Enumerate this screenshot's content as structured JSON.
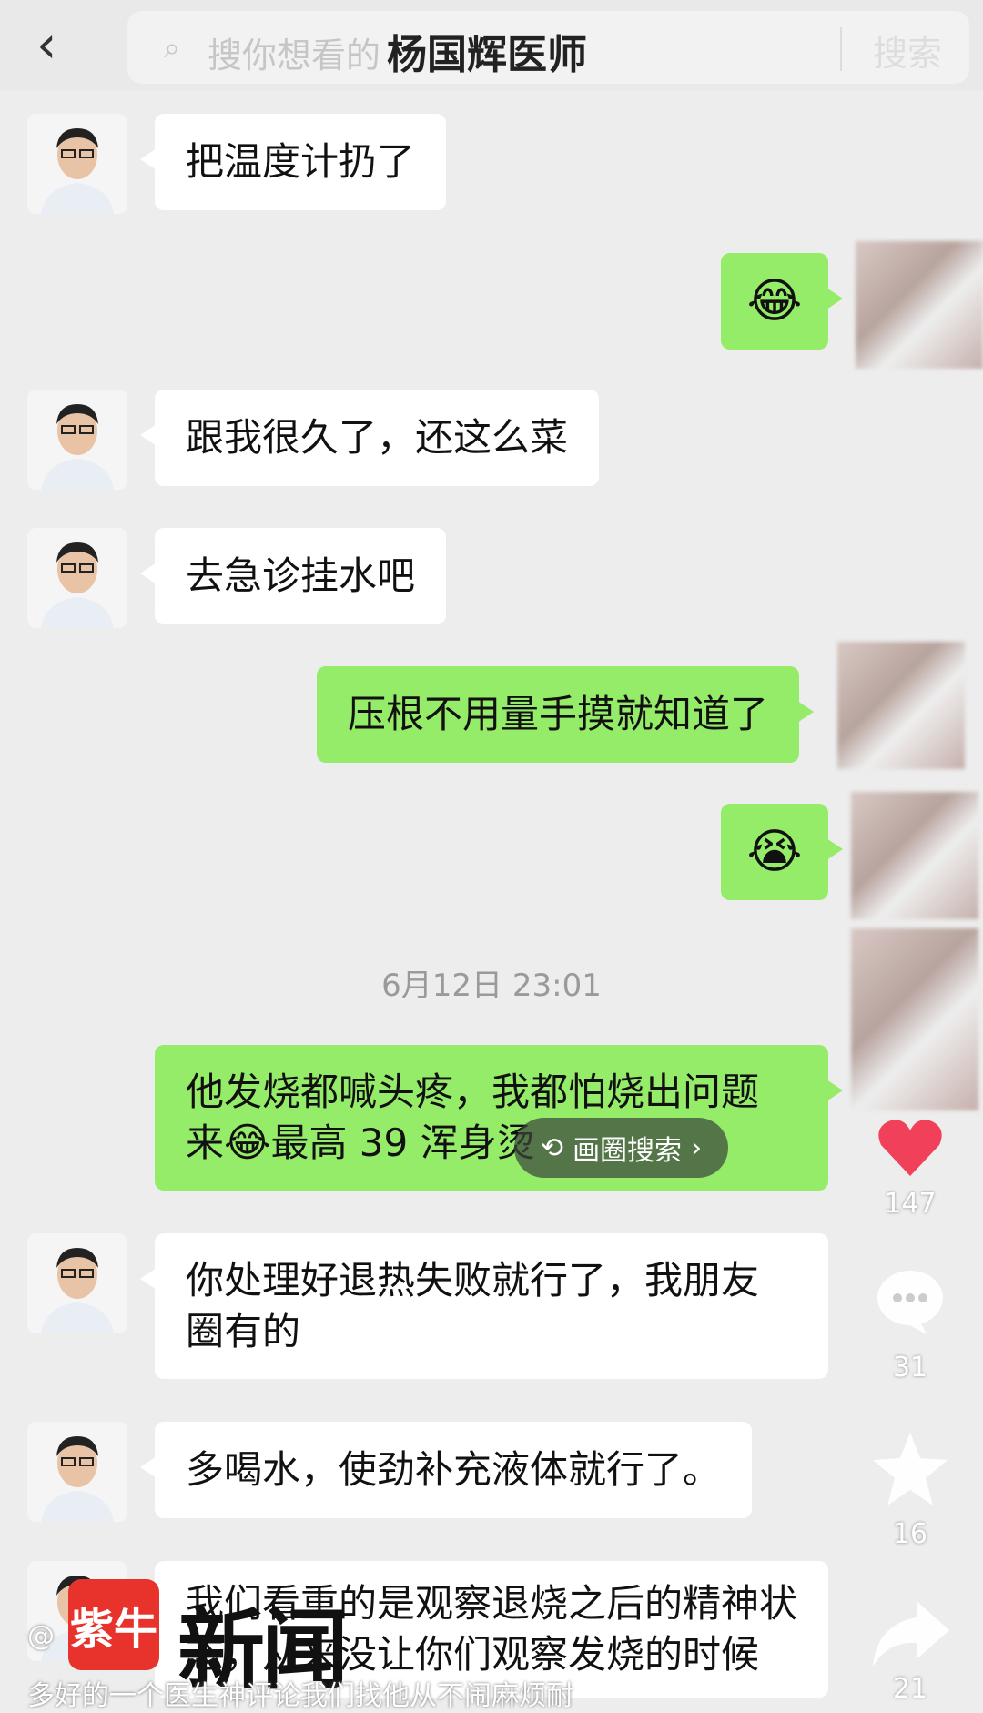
{
  "header": {
    "back_icon": "back-arrow-icon",
    "search_placeholder": "搜你想看的",
    "doctor_name": "杨国辉医师",
    "search_button": "搜索"
  },
  "messages": [
    {
      "side": "left",
      "text": "把温度计扔了"
    },
    {
      "side": "right",
      "emoji": "😂"
    },
    {
      "side": "left",
      "text": "跟我很久了，还这么菜"
    },
    {
      "side": "left",
      "text": "去急诊挂水吧"
    },
    {
      "side": "right",
      "text": "压根不用量手摸就知道了"
    },
    {
      "side": "right",
      "emoji": "😭"
    },
    {
      "side": "right",
      "line1": "他发烧都喊头疼，我都怕烧出问题",
      "line2a": "来",
      "line2_emoji": "😂",
      "line2b": "最高 39 浑身烫"
    },
    {
      "side": "left",
      "line1": "你处理好退热失败就行了，我朋友",
      "line2": "圈有的"
    },
    {
      "side": "left",
      "text": "多喝水，使劲补充液体就行了。"
    },
    {
      "side": "left",
      "line1": "我们看重的是观察退烧之后的精神状",
      "line2": "态，从来没让你们观察发烧的时候"
    }
  ],
  "timestamp": "6月12日 23:01",
  "circle_search": "画圈搜索",
  "rail": {
    "like_count": "147",
    "comment_count": "31",
    "favorite_count": "16",
    "share_count": "21"
  },
  "watermark": {
    "logo_text": "紫牛",
    "word": "新闻"
  },
  "caption_line": "@",
  "caption_bottom": "多好的一个医生神评论我们找他从不闹麻烦耐"
}
